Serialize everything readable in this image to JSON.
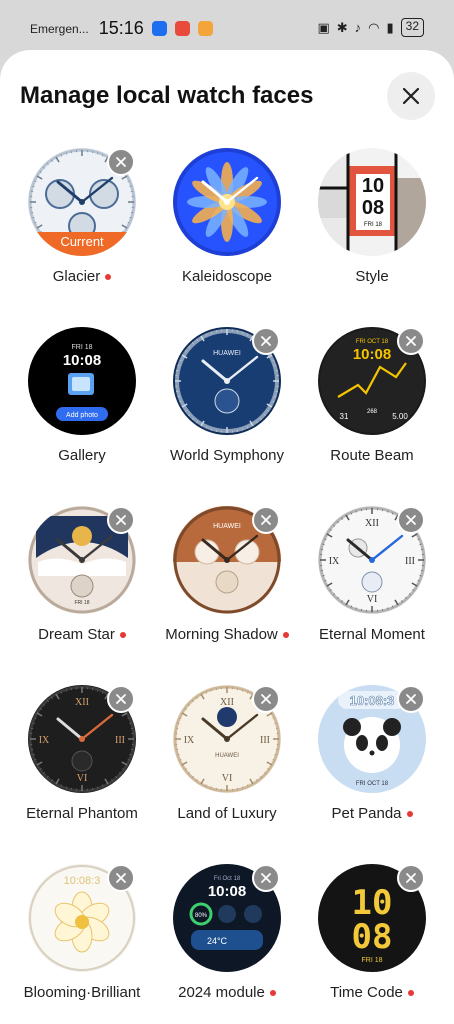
{
  "status_bar": {
    "carrier": "Emergen...",
    "time": "15:16",
    "battery": "32"
  },
  "header": {
    "title": "Manage local watch faces"
  },
  "current_tag": "Current",
  "faces": [
    {
      "label": "Glacier",
      "dot": true,
      "deletable": true,
      "current": true,
      "style": "glacier"
    },
    {
      "label": "Kaleidoscope",
      "dot": false,
      "deletable": false,
      "current": false,
      "style": "kaleido"
    },
    {
      "label": "Style",
      "dot": false,
      "deletable": false,
      "current": false,
      "style": "style",
      "date": "FRI 18",
      "hour": "10",
      "minute": "08"
    },
    {
      "label": "Gallery",
      "dot": false,
      "deletable": false,
      "current": false,
      "style": "gallery",
      "date": "FRI 18",
      "time": "10:08",
      "button": "Add photo"
    },
    {
      "label": "World Symphony",
      "dot": false,
      "deletable": true,
      "current": false,
      "style": "world",
      "brand": "HUAWEI"
    },
    {
      "label": "Route Beam",
      "dot": false,
      "deletable": true,
      "current": false,
      "style": "route",
      "date": "FRI OCT 18",
      "time": "10:08",
      "left_stat": "31",
      "center_stat": "268",
      "right_stat": "5.00"
    },
    {
      "label": "Dream Star",
      "dot": true,
      "deletable": true,
      "current": false,
      "style": "dream",
      "date": "FRI 18"
    },
    {
      "label": "Morning Shadow",
      "dot": true,
      "deletable": true,
      "current": false,
      "style": "morning",
      "brand": "HUAWEI"
    },
    {
      "label": "Eternal Moment",
      "dot": false,
      "deletable": true,
      "current": false,
      "style": "eternal"
    },
    {
      "label": "Eternal Phantom",
      "dot": false,
      "deletable": true,
      "current": false,
      "style": "phantom"
    },
    {
      "label": "Land of Luxury",
      "dot": false,
      "deletable": true,
      "current": false,
      "style": "luxury",
      "brand": "HUAWEI"
    },
    {
      "label": "Pet Panda",
      "dot": true,
      "deletable": true,
      "current": false,
      "style": "panda",
      "time": "10:08:3",
      "date": "FRI OCT 18"
    },
    {
      "label": "Blooming·Brilliant",
      "dot": false,
      "deletable": true,
      "current": false,
      "style": "bloom",
      "time": "10:08:3"
    },
    {
      "label": "2024 module",
      "dot": true,
      "deletable": true,
      "current": false,
      "style": "module",
      "date": "Fri Oct 18",
      "time": "10:08",
      "battery": "80%",
      "temp": "24°C"
    },
    {
      "label": "Time Code",
      "dot": true,
      "deletable": true,
      "current": false,
      "style": "timecode",
      "hour": "10",
      "minute": "08",
      "date": "FRI 18"
    }
  ]
}
